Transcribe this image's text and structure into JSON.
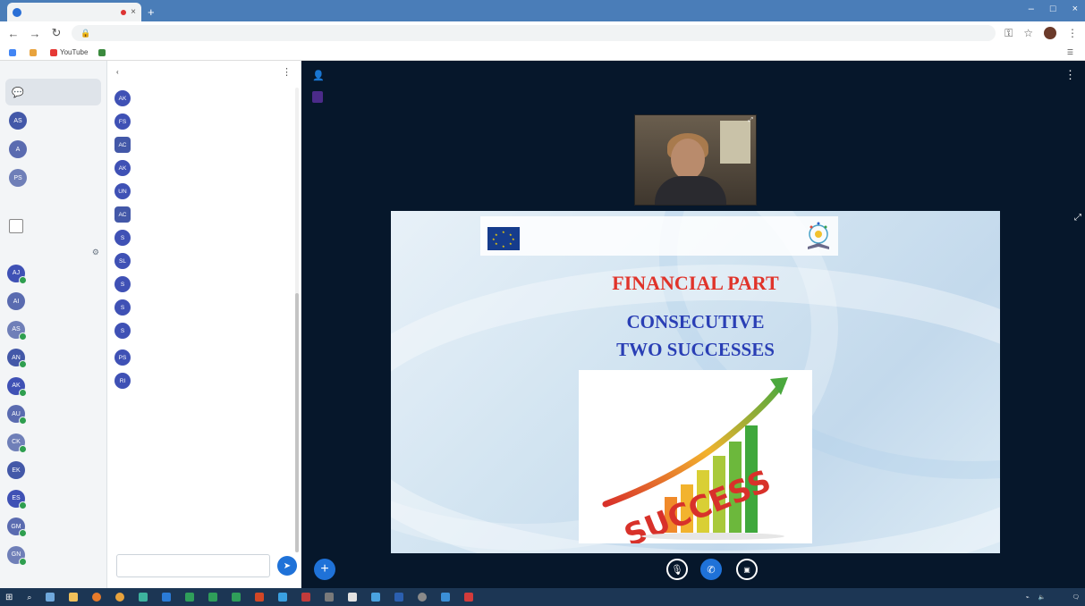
{
  "browser": {
    "tab_title": "",
    "tab_close": "×",
    "new_tab": "+",
    "window_controls": [
      "–",
      "□",
      "×"
    ],
    "address": "",
    "bookmarks": [
      {
        "label": "",
        "color": "#4285f4"
      },
      {
        "label": "",
        "color": "#e8a33d"
      },
      {
        "label": "YouTube",
        "color": "#e53935"
      },
      {
        "label": "",
        "color": "#3b8a3e"
      }
    ],
    "bookmarks_right": ""
  },
  "userpanel": {
    "messages_header": "",
    "chats": [
      {
        "label": "",
        "avatar": "",
        "active": true
      },
      {
        "label": "",
        "avatar": "AS",
        "active": false
      },
      {
        "label": "",
        "avatar": "A",
        "active": false
      },
      {
        "label": "",
        "avatar": "PS",
        "active": false
      }
    ],
    "notes_header": "",
    "notes_item": "",
    "users_header": "",
    "users": [
      {
        "name": "",
        "initials": "AJ",
        "online": true
      },
      {
        "name": "",
        "initials": "AI",
        "online": false
      },
      {
        "name": "",
        "initials": "AS",
        "online": true
      },
      {
        "name": "",
        "initials": "AN",
        "online": true
      },
      {
        "name": "",
        "initials": "AK",
        "online": true
      },
      {
        "name": "",
        "initials": "AU",
        "online": true
      },
      {
        "name": "",
        "initials": "CK",
        "online": true
      },
      {
        "name": "",
        "initials": "EK",
        "online": false
      },
      {
        "name": "",
        "initials": "ES",
        "online": true
      },
      {
        "name": "",
        "initials": "GM",
        "online": true
      },
      {
        "name": "",
        "initials": "GN",
        "online": true
      }
    ]
  },
  "chat": {
    "header": "",
    "messages": [
      {
        "name": "",
        "time": "",
        "text": "",
        "initials": "AK",
        "style": "round"
      },
      {
        "name": "",
        "time": "",
        "text": "",
        "initials": "FS",
        "style": "round"
      },
      {
        "name": "",
        "time": "",
        "text": "",
        "initials": "АС",
        "style": "square"
      },
      {
        "name": "",
        "time": "",
        "text": "",
        "initials": "AK",
        "style": "round"
      },
      {
        "name": "",
        "time": "",
        "text": "",
        "initials": "UN",
        "style": "round"
      },
      {
        "name": "",
        "time": "",
        "text": "",
        "initials": "АС",
        "style": "square"
      },
      {
        "name": "",
        "time": "",
        "text": "",
        "initials": "S",
        "style": "round"
      },
      {
        "name": "",
        "time": "",
        "text": "",
        "initials": "SL",
        "style": "round"
      },
      {
        "name": "",
        "time": "",
        "text": "",
        "initials": "S",
        "style": "round"
      },
      {
        "name": "",
        "time": "",
        "text": "",
        "initials": "S",
        "style": "round"
      },
      {
        "name": "",
        "time": "",
        "text": "",
        "initials": "S",
        "style": "round"
      }
    ],
    "continuation": "",
    "messages2": [
      {
        "name": "",
        "time": "",
        "text": "",
        "initials": "PS",
        "style": "round"
      },
      {
        "name": "",
        "time": "",
        "text": "",
        "initials": "RI",
        "style": "round"
      }
    ],
    "input_placeholder": "",
    "send_icon": "➤"
  },
  "stage": {
    "title": "",
    "talking_badge": "",
    "webcam_label": "",
    "slide": {
      "eu_text": "",
      "project_text": "",
      "title": "FINANCIAL PART",
      "subtitle_1": "CONSECUTIVE",
      "subtitle_2": "TWO SUCCESSES",
      "page_number": "",
      "image_word": "SUCCESS"
    },
    "controls": {
      "plus": "+",
      "mic": "🎙",
      "phone": "✆",
      "cam": "▣"
    }
  },
  "taskbar": {
    "tray_lang": "",
    "time": "",
    "date": ""
  },
  "colors": {
    "accent": "#1f72d8",
    "stage_bg": "#06172b",
    "slide_title": "#e0332a",
    "slide_subtitle": "#2a3fb5",
    "badge": "#4b2b8a",
    "online": "#2e9e4f"
  }
}
